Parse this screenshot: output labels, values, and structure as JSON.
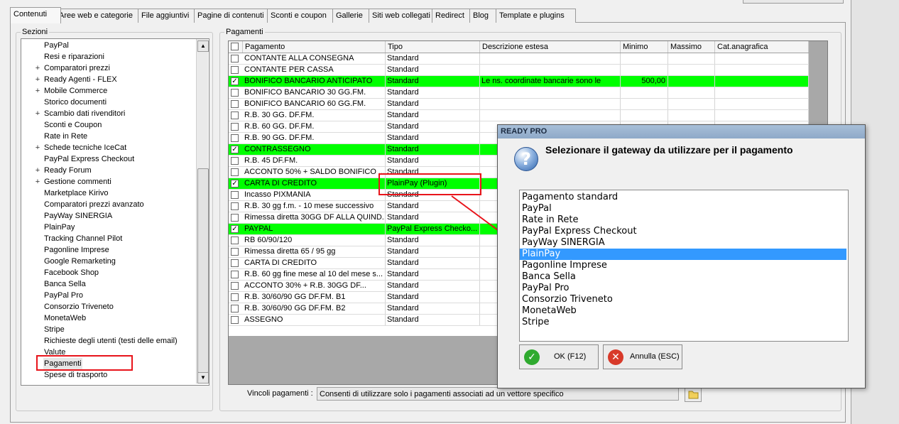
{
  "tabs": [
    {
      "label": "Contenuti",
      "active": true
    },
    {
      "label": "Aree web e categorie"
    },
    {
      "label": "File aggiuntivi"
    },
    {
      "label": "Pagine di contenuti"
    },
    {
      "label": "Sconti e coupon"
    },
    {
      "label": "Gallerie"
    },
    {
      "label": "Siti web collegati"
    },
    {
      "label": "Redirect"
    },
    {
      "label": "Blog"
    },
    {
      "label": "Template e plugins"
    }
  ],
  "sections": {
    "title": "Sezioni",
    "items": [
      {
        "label": "PayPal",
        "expandable": false
      },
      {
        "label": "Resi e riparazioni",
        "expandable": false
      },
      {
        "label": "Comparatori prezzi",
        "expandable": true
      },
      {
        "label": "Ready Agenti - FLEX",
        "expandable": true
      },
      {
        "label": "Mobile Commerce",
        "expandable": true
      },
      {
        "label": "Storico documenti",
        "expandable": false
      },
      {
        "label": "Scambio dati rivenditori",
        "expandable": true
      },
      {
        "label": "Sconti e Coupon",
        "expandable": false
      },
      {
        "label": "Rate in Rete",
        "expandable": false
      },
      {
        "label": "Schede tecniche IceCat",
        "expandable": true
      },
      {
        "label": "PayPal Express Checkout",
        "expandable": false
      },
      {
        "label": "Ready Forum",
        "expandable": true
      },
      {
        "label": "Gestione commenti",
        "expandable": true
      },
      {
        "label": "Marketplace Kirivo",
        "expandable": false
      },
      {
        "label": "Comparatori prezzi avanzato",
        "expandable": false
      },
      {
        "label": "PayWay SINERGIA",
        "expandable": false
      },
      {
        "label": "PlainPay",
        "expandable": false
      },
      {
        "label": "Tracking Channel Pilot",
        "expandable": false
      },
      {
        "label": "Pagonline Imprese",
        "expandable": false
      },
      {
        "label": "Google Remarketing",
        "expandable": false
      },
      {
        "label": "Facebook Shop",
        "expandable": false
      },
      {
        "label": "Banca Sella",
        "expandable": false
      },
      {
        "label": "PayPal Pro",
        "expandable": false
      },
      {
        "label": "Consorzio Triveneto",
        "expandable": false
      },
      {
        "label": "MonetaWeb",
        "expandable": false
      },
      {
        "label": "Stripe",
        "expandable": false
      },
      {
        "label": "Richieste degli utenti (testi delle email)",
        "expandable": false
      },
      {
        "label": "Valute",
        "expandable": false
      },
      {
        "label": "Pagamenti",
        "expandable": false,
        "selected": true
      },
      {
        "label": "Spese di trasporto",
        "expandable": false
      }
    ]
  },
  "payments": {
    "title": "Pagamenti",
    "columns": [
      "Pagamento",
      "Tipo",
      "Descrizione estesa",
      "Minimo",
      "Massimo",
      "Cat.anagrafica"
    ],
    "rows": [
      {
        "checked": false,
        "green": false,
        "pagamento": "CONTANTE ALLA CONSEGNA",
        "tipo": "Standard",
        "descrizione": "",
        "minimo": ""
      },
      {
        "checked": false,
        "green": false,
        "pagamento": "CONTANTE PER CASSA",
        "tipo": "Standard",
        "descrizione": "",
        "minimo": ""
      },
      {
        "checked": true,
        "green": true,
        "pagamento": "BONIFICO BANCARIO ANTICIPATO",
        "tipo": "Standard",
        "descrizione": "Le ns. coordinate bancarie sono le",
        "minimo": "500,00"
      },
      {
        "checked": false,
        "green": false,
        "pagamento": "BONIFICO BANCARIO 30 GG.FM.",
        "tipo": "Standard",
        "descrizione": "",
        "minimo": ""
      },
      {
        "checked": false,
        "green": false,
        "pagamento": "BONIFICO BANCARIO 60 GG.FM.",
        "tipo": "Standard",
        "descrizione": "",
        "minimo": ""
      },
      {
        "checked": false,
        "green": false,
        "pagamento": "R.B. 30 GG. DF.FM.",
        "tipo": "Standard",
        "descrizione": "",
        "minimo": ""
      },
      {
        "checked": false,
        "green": false,
        "pagamento": "R.B. 60 GG. DF.FM.",
        "tipo": "Standard",
        "descrizione": "",
        "minimo": ""
      },
      {
        "checked": false,
        "green": false,
        "pagamento": "R.B. 90 GG. DF.FM.",
        "tipo": "Standard",
        "descrizione": "",
        "minimo": ""
      },
      {
        "checked": true,
        "green": true,
        "pagamento": "CONTRASSEGNO",
        "tipo": "Standard",
        "descrizione": "",
        "minimo": ""
      },
      {
        "checked": false,
        "green": false,
        "pagamento": "R.B. 45 DF.FM.",
        "tipo": "Standard",
        "descrizione": "",
        "minimo": ""
      },
      {
        "checked": false,
        "green": false,
        "pagamento": "ACCONTO 50% + SALDO BONIFICO ...",
        "tipo": "Standard",
        "descrizione": "",
        "minimo": ""
      },
      {
        "checked": true,
        "green": true,
        "pagamento": "CARTA DI CREDITO",
        "tipo": "PlainPay (Plugin)",
        "descrizione": "",
        "minimo": ""
      },
      {
        "checked": false,
        "green": false,
        "pagamento": "Incasso PIXMANIA",
        "tipo": "Standard",
        "descrizione": "",
        "minimo": ""
      },
      {
        "checked": false,
        "green": false,
        "pagamento": "R.B. 30 gg f.m. - 10 mese successivo",
        "tipo": "Standard",
        "descrizione": "",
        "minimo": ""
      },
      {
        "checked": false,
        "green": false,
        "pagamento": "Rimessa diretta 30GG DF ALLA QUIND...",
        "tipo": "Standard",
        "descrizione": "",
        "minimo": ""
      },
      {
        "checked": true,
        "green": true,
        "pagamento": "PAYPAL",
        "tipo": "PayPal Express Checko...",
        "descrizione": "",
        "minimo": ""
      },
      {
        "checked": false,
        "green": false,
        "pagamento": "RB 60/90/120",
        "tipo": "Standard",
        "descrizione": "",
        "minimo": ""
      },
      {
        "checked": false,
        "green": false,
        "pagamento": "Rimessa diretta 65 / 95 gg",
        "tipo": "Standard",
        "descrizione": "",
        "minimo": ""
      },
      {
        "checked": false,
        "green": false,
        "pagamento": "CARTA DI CREDITO",
        "tipo": "Standard",
        "descrizione": "",
        "minimo": ""
      },
      {
        "checked": false,
        "green": false,
        "pagamento": "R.B. 60 gg fine mese al 10 del mese s...",
        "tipo": "Standard",
        "descrizione": "",
        "minimo": ""
      },
      {
        "checked": false,
        "green": false,
        "pagamento": "ACCONTO 30% + R.B. 30GG DF...",
        "tipo": "Standard",
        "descrizione": "",
        "minimo": ""
      },
      {
        "checked": false,
        "green": false,
        "pagamento": "R.B. 30/60/90 GG DF.FM. B1",
        "tipo": "Standard",
        "descrizione": "",
        "minimo": ""
      },
      {
        "checked": false,
        "green": false,
        "pagamento": "R.B. 30/60/90 GG DF.FM. B2",
        "tipo": "Standard",
        "descrizione": "",
        "minimo": ""
      },
      {
        "checked": false,
        "green": false,
        "pagamento": "ASSEGNO",
        "tipo": "Standard",
        "descrizione": "",
        "minimo": ""
      }
    ]
  },
  "vincoli": {
    "label": "Vincoli pagamenti :",
    "value": "Consenti di utilizzare solo i pagamenti associati ad un vettore specifico"
  },
  "dialog": {
    "title": "READY PRO",
    "message": "Selezionare il gateway da utilizzare per il pagamento",
    "options": [
      "Pagamento standard",
      "PayPal",
      "Rate in Rete",
      "PayPal Express Checkout",
      "PayWay SINERGIA",
      "PlainPay",
      "Pagonline Imprese",
      "Banca Sella",
      "PayPal Pro",
      "Consorzio Triveneto",
      "MonetaWeb",
      "Stripe"
    ],
    "selected_option": "PlainPay",
    "ok_label": "OK (F12)",
    "cancel_label": "Annulla (ESC)"
  },
  "colors": {
    "row_highlight": "#00ff00",
    "list_selection": "#3399ff",
    "annotation_red": "#e8141b",
    "ok_icon": "#2faa2f",
    "cancel_icon": "#d83a2a"
  }
}
